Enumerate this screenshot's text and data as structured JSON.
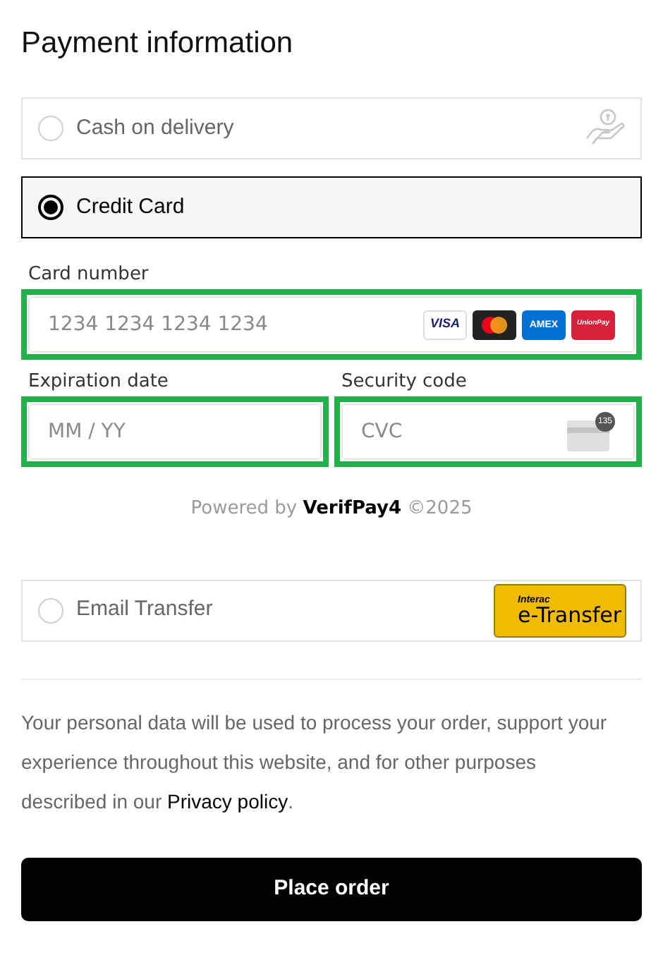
{
  "title": "Payment information",
  "methods": [
    {
      "kind": "cash",
      "label": "Cash on delivery",
      "selected": false
    },
    {
      "kind": "card",
      "label": "Credit Card",
      "selected": true,
      "fields": [
        {
          "kind": "number",
          "label": "Card number",
          "placeholder": "1234 1234 1234 1234",
          "highlighted": true,
          "brands": [
            {
              "kind": "visa",
              "label": "VISA"
            },
            {
              "kind": "mastercard"
            },
            {
              "kind": "amex",
              "label": "AMEX"
            },
            {
              "kind": "unionpay",
              "label": "UnionPay"
            }
          ]
        },
        {
          "kind": "expiry",
          "label": "Expiration date",
          "placeholder": "MM / YY",
          "highlighted": true
        },
        {
          "kind": "cvc",
          "label": "Security code",
          "placeholder": "CVC",
          "highlighted": true,
          "badge": "135"
        }
      ],
      "powered": {
        "prefix": "Powered by",
        "brand": "VerifPay4",
        "suffix": "©2025"
      }
    },
    {
      "kind": "email",
      "label": "Email Transfer",
      "selected": false,
      "logo": {
        "top": "Interac",
        "bottom": "e-Transfer"
      }
    }
  ],
  "notice": {
    "text": "Your personal data will be used to process your order, support your experience throughout this website, and for other purposes described in our",
    "link": "Privacy policy",
    "end": "."
  },
  "button": "Place order"
}
